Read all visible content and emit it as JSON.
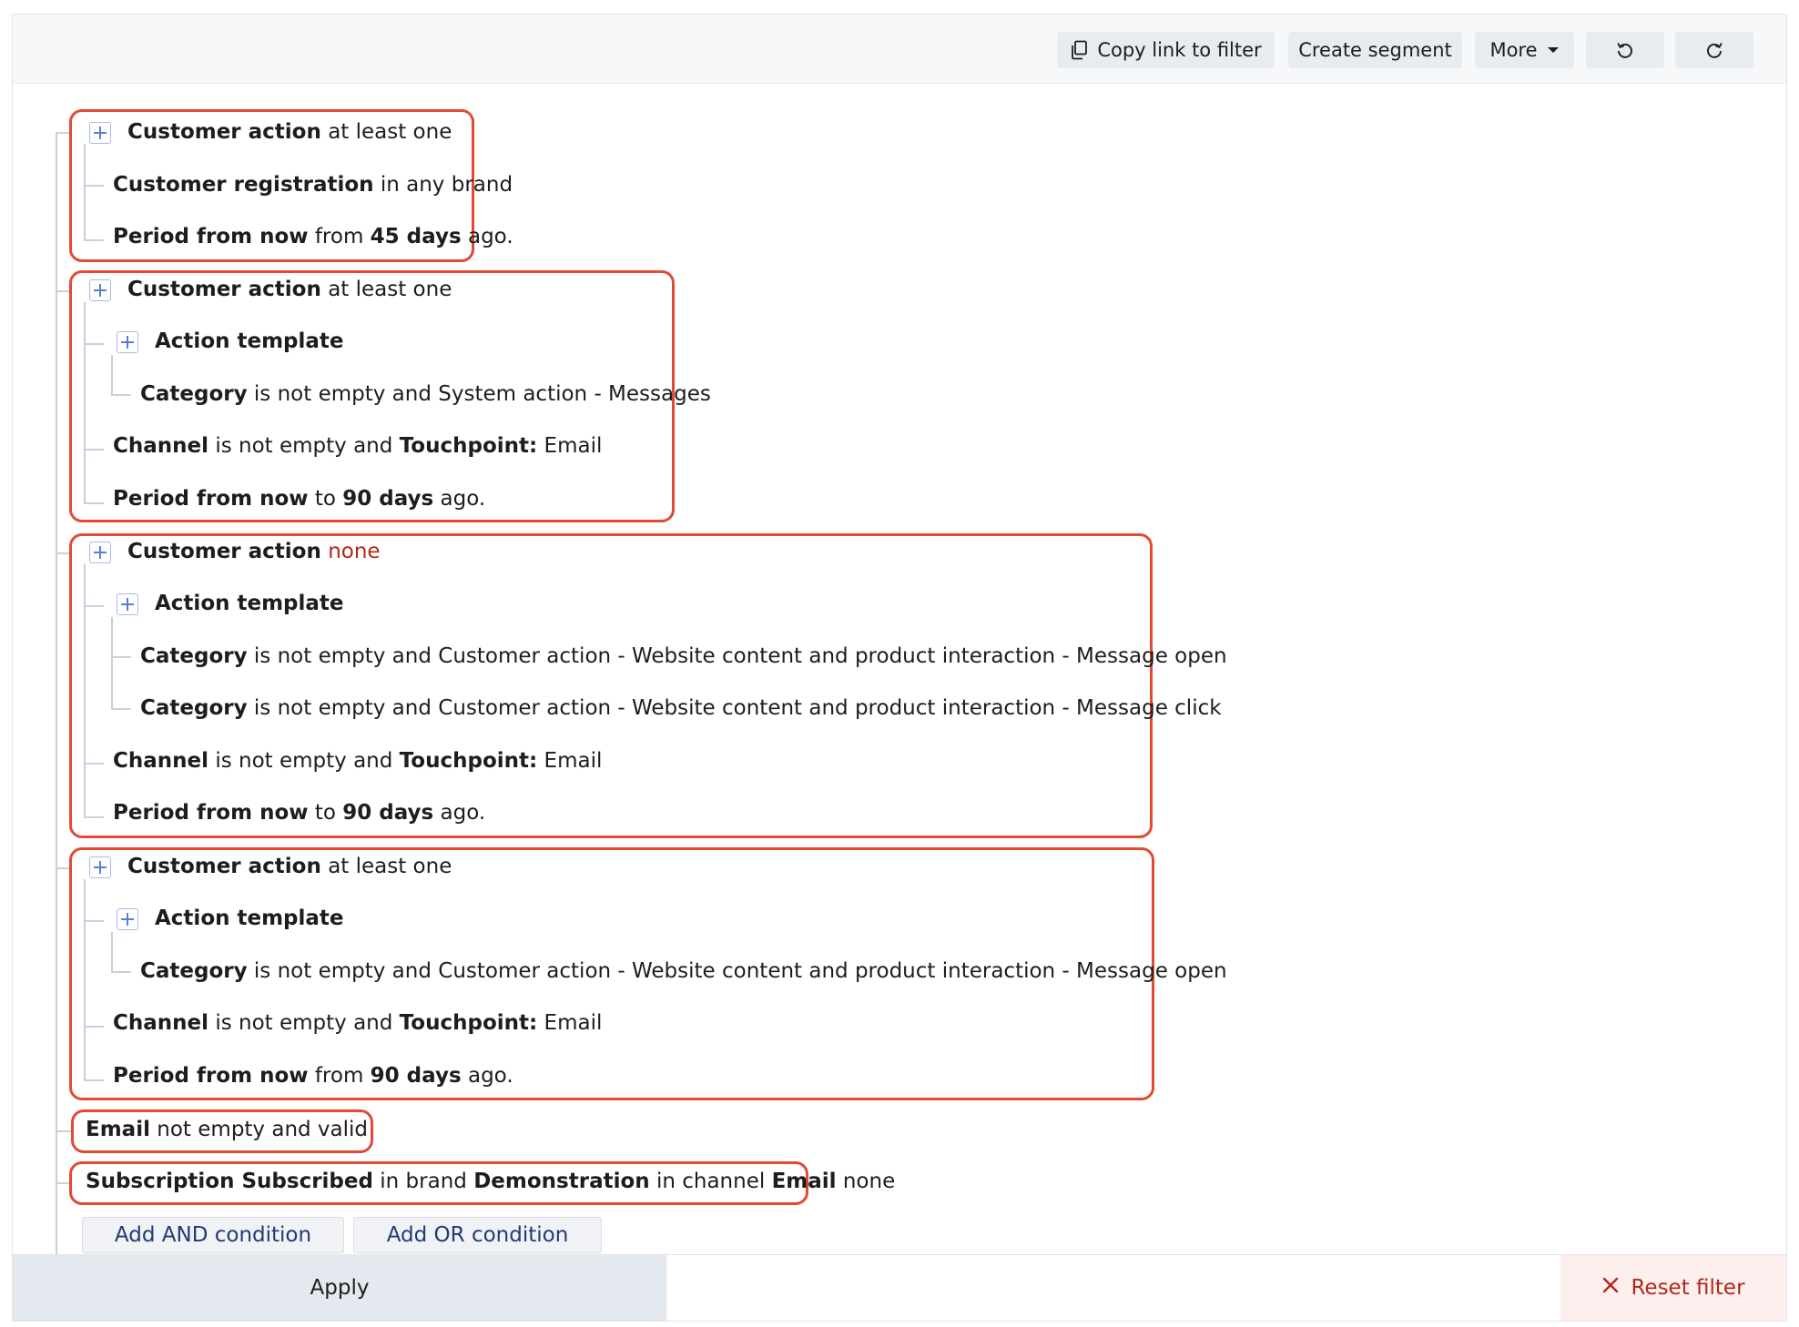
{
  "toolbar": {
    "copy_link_label": "Copy link to filter",
    "create_segment_label": "Create segment",
    "more_label": "More"
  },
  "groups": [
    {
      "head": {
        "title": "Customer action",
        "qualifier": "at least one"
      },
      "registration": {
        "title": "Customer registration",
        "text": "in any brand"
      },
      "period": {
        "title": "Period from now",
        "mid": "from",
        "value": "45 days",
        "suffix": "ago."
      }
    },
    {
      "head": {
        "title": "Customer action",
        "qualifier": "at least one"
      },
      "template": {
        "title": "Action template",
        "categories": [
          {
            "title": "Category",
            "text": "is not empty and System action - Messages"
          }
        ]
      },
      "channel": {
        "title": "Channel",
        "mid": "is not empty and",
        "title2": "Touchpoint:",
        "value": "Email"
      },
      "period": {
        "title": "Period from now",
        "mid": "to",
        "value": "90 days",
        "suffix": "ago."
      }
    },
    {
      "head": {
        "title": "Customer action",
        "qualifier": "none"
      },
      "template": {
        "title": "Action template",
        "categories": [
          {
            "title": "Category",
            "text": "is not empty and Customer action - Website content and product interaction - Message open"
          },
          {
            "title": "Category",
            "text": "is not empty and Customer action - Website content and product interaction - Message click"
          }
        ]
      },
      "channel": {
        "title": "Channel",
        "mid": "is not empty and",
        "title2": "Touchpoint:",
        "value": "Email"
      },
      "period": {
        "title": "Period from now",
        "mid": "to",
        "value": "90 days",
        "suffix": "ago."
      }
    },
    {
      "head": {
        "title": "Customer action",
        "qualifier": "at least one"
      },
      "template": {
        "title": "Action template",
        "categories": [
          {
            "title": "Category",
            "text": "is not empty and Customer action - Website content and product interaction - Message open"
          }
        ]
      },
      "channel": {
        "title": "Channel",
        "mid": "is not empty and",
        "title2": "Touchpoint:",
        "value": "Email"
      },
      "period": {
        "title": "Period from now",
        "mid": "from",
        "value": "90 days",
        "suffix": "ago."
      }
    }
  ],
  "email_condition": {
    "title": "Email",
    "text": "not empty and valid"
  },
  "subscription_condition": {
    "title": "Subscription Subscribed",
    "mid1": "in brand",
    "brand": "Demonstration",
    "mid2": "in channel",
    "channel": "Email",
    "suffix": "none"
  },
  "actions": {
    "add_and_label": "Add AND condition",
    "add_or_label": "Add OR condition"
  },
  "footer": {
    "apply_label": "Apply",
    "reset_label": "Reset filter"
  },
  "colors": {
    "highlight": "#e24a35",
    "negation": "#b0281a",
    "icon_blue": "#5b7ed0"
  }
}
